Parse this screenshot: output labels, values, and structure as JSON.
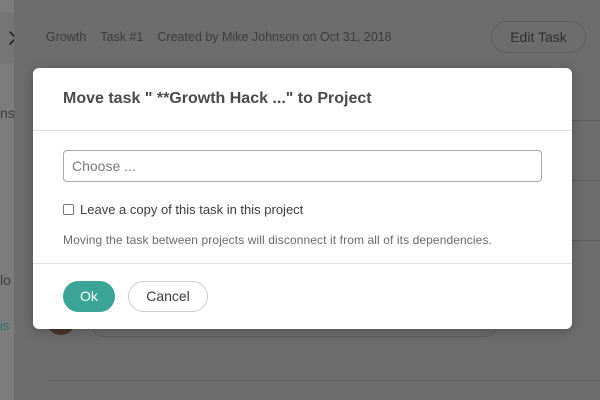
{
  "background": {
    "breadcrumb": [
      "Growth",
      "Task #1",
      "Created by Mike Johnson on Oct 31, 2018"
    ],
    "edit_task_label": "Edit Task",
    "left_fragments": [
      "ns",
      "lo",
      "is"
    ]
  },
  "modal": {
    "title": "Move task \" **Growth Hack ...\" to Project",
    "select_placeholder": "Choose ...",
    "checkbox_label": "Leave a copy of this task in this project",
    "checkbox_checked": false,
    "note": "Moving the task between projects will disconnect it from all of its dependencies.",
    "ok_label": "Ok",
    "cancel_label": "Cancel"
  },
  "colors": {
    "accent": "#3aa597",
    "overlay": "#6f6f6f"
  }
}
